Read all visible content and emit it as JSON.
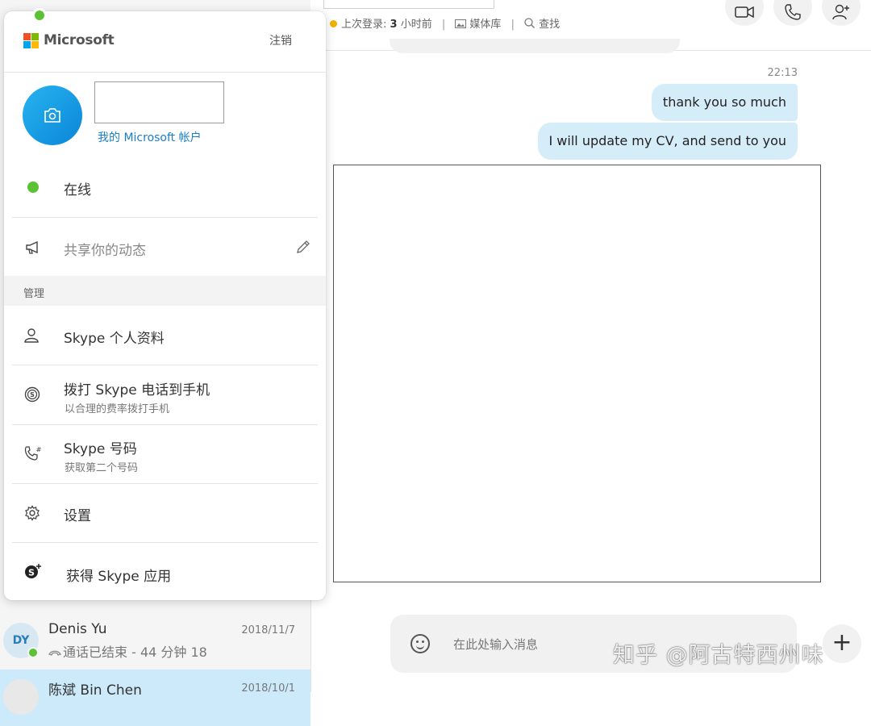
{
  "header": {
    "last_login_prefix": "上次登录:",
    "last_login_value": "3",
    "last_login_suffix": "小时前",
    "media_library": "媒体库",
    "search": "查找"
  },
  "conversation": {
    "time": "22:13",
    "messages": [
      {
        "text": "thank you so much"
      },
      {
        "text": "I will update my CV, and send to you"
      }
    ]
  },
  "composer": {
    "placeholder": "在此处输入消息"
  },
  "contacts": [
    {
      "initials": "DY",
      "name": "Denis Yu",
      "date": "2018/11/7",
      "subtitle": "通话已结束 - 44 分钟 18"
    },
    {
      "name": "陈斌 Bin Chen",
      "date": "2018/10/1"
    }
  ],
  "popup": {
    "brand": "Microsoft",
    "sign_out": "注销",
    "account_link": "我的 Microsoft 帐户",
    "status": "在线",
    "mood_placeholder": "共享你的动态",
    "section_title": "管理",
    "menu": [
      {
        "icon": "person-icon",
        "title": "Skype 个人资料"
      },
      {
        "icon": "skype-credit-icon",
        "title": "拨打 Skype 电话到手机",
        "desc": "以合理的费率拨打手机"
      },
      {
        "icon": "phone-number-icon",
        "title": "Skype 号码",
        "desc": "获取第二个号码"
      },
      {
        "icon": "gear-icon",
        "title": "设置"
      },
      {
        "icon": "skype-app-icon",
        "title": "获得 Skype 应用"
      }
    ]
  },
  "watermark": "知乎 @阿古特西州味",
  "colors": {
    "accent": "#0b86d8",
    "bubble": "#d5edf9",
    "online": "#5bc236",
    "selected_contact": "#cdeafa"
  }
}
